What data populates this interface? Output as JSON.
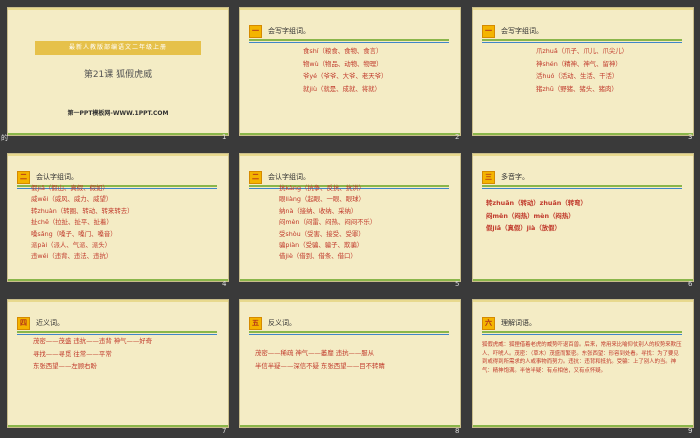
{
  "slides": [
    {
      "page": "1",
      "banner": "最新人教版部编语文二年级上册",
      "title": "第21课  狐假虎威",
      "footer": "第一PPT模板网-WWW.1PPT.COM"
    },
    {
      "page": "2",
      "badge": "一",
      "heading": "会写字组词。",
      "lines": [
        "食shí（粮食、食物、食言）",
        "物wù（物品、动物、物理）",
        "爷yé（爷爷、大爷、老天爷）",
        "就jiù（就是、成就、将就）"
      ]
    },
    {
      "page": "3",
      "badge": "一",
      "heading": "会写字组词。",
      "lines": [
        "爪zhuǎ（爪子、爪儿、爪尖儿）",
        "神shén（精神、神气、留神）",
        "活huó（活动、生活、干活）",
        "猪zhū（野猪、猪头、猪肉）"
      ]
    },
    {
      "page": "4",
      "badge": "二",
      "heading": "会认字组词。",
      "lines": [
        "假jiǎ（假山、真假、假如）",
        "威wēi（威风、威力、威望）",
        "转zhuàn（转圈、转动、转来转去）",
        "扯chě（拉扯、扯平、扯着）",
        "嗓sǎng（嗓子、嗓门、嗓音）",
        "派pài（派人、气派、派头）",
        "违wéi（违背、违法、违抗）"
      ]
    },
    {
      "page": "5",
      "badge": "二",
      "heading": "会认字组词。",
      "lines": [
        "抗kàng（抗争、反抗、抗洪）",
        "眼liàng（起眼、一眼、眼球）",
        "纳nà（接纳、收纳、采纳）",
        "闷mèn（闷雷、闷热、闷闷不乐）",
        "受shòu（受害、接受、受罪）",
        "骗piàn（受骗、骗子、欺骗）",
        "借jiè（借到、借条、借口）"
      ]
    },
    {
      "page": "6",
      "badge": "三",
      "heading": "多音字。",
      "lines": [
        "转zhuǎn（转动）zhuǎn（转弯）",
        "闷mēn（闷热）mèn（闷热）",
        "假jiǎ（真假）jià（放假）"
      ]
    },
    {
      "page": "7",
      "badge": "四",
      "heading": "近义词。",
      "lines": [
        "茂密——茂盛  违抗——违背  神气——好奇",
        "寻找——寻觅  往常——平常",
        "东张西望——左顾右盼"
      ]
    },
    {
      "page": "8",
      "badge": "五",
      "heading": "反义词。",
      "lines": [
        "茂密——稀疏  神气——萎靡  违抗——服从",
        "半信半疑——深信不疑  东张西望——目不转睛"
      ]
    },
    {
      "page": "9",
      "badge": "六",
      "heading": "理解词语。",
      "text": "狐假虎威：狐狸借着老虎的威势吓退百兽。后来，常用来比喻仰仗别人的权势来欺压人、吓唬人。茂密：（草木）茂盛而繁密。东张西望：形容到处看。寻找：为了要见到或得到所需求的人或事物而努力。违抗：违背和抵抗。受骗：上了别人的当。神气：精神饱满。半信半疑：有点相信，又有点怀疑。"
    }
  ],
  "left_label": "的"
}
